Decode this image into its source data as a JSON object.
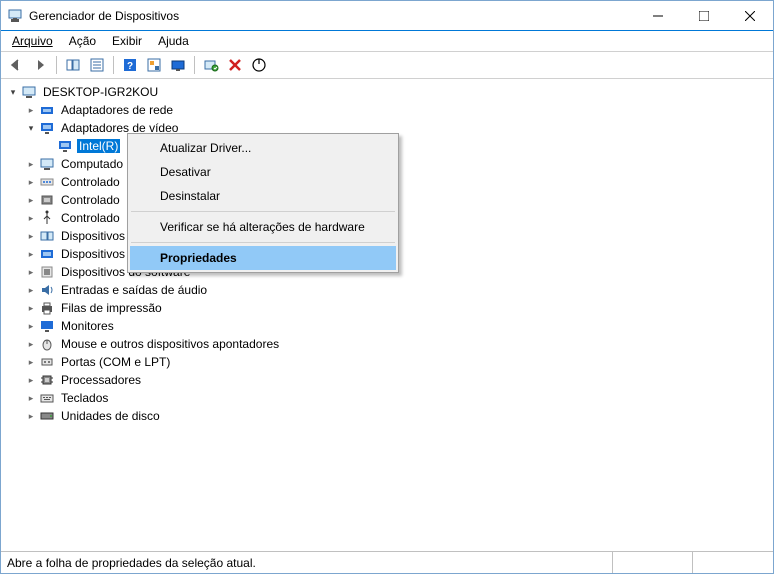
{
  "window": {
    "title": "Gerenciador de Dispositivos"
  },
  "menubar": {
    "file": "Arquivo",
    "action": "Ação",
    "view": "Exibir",
    "help": "Ajuda"
  },
  "tree": {
    "root": "DESKTOP-IGR2KOU",
    "net": "Adaptadores de rede",
    "video": "Adaptadores de vídeo",
    "intel": "Intel(R)",
    "computer": "Computado",
    "controller1": "Controlado",
    "controller2": "Controlado",
    "controller3": "Controlado",
    "devices1": "Dispositivos",
    "devices2": "Dispositivos",
    "devices3": "Dispositivos do software",
    "audio": "Entradas e saídas de áudio",
    "print": "Filas de impressão",
    "monitors": "Monitores",
    "mouse": "Mouse e outros dispositivos apontadores",
    "ports": "Portas (COM e LPT)",
    "processors": "Processadores",
    "keyboards": "Teclados",
    "disks": "Unidades de disco"
  },
  "context_menu": {
    "update": "Atualizar Driver...",
    "disable": "Desativar",
    "uninstall": "Desinstalar",
    "scan": "Verificar se há alterações de hardware",
    "properties": "Propriedades"
  },
  "statusbar": {
    "text": "Abre a folha de propriedades da seleção atual."
  }
}
